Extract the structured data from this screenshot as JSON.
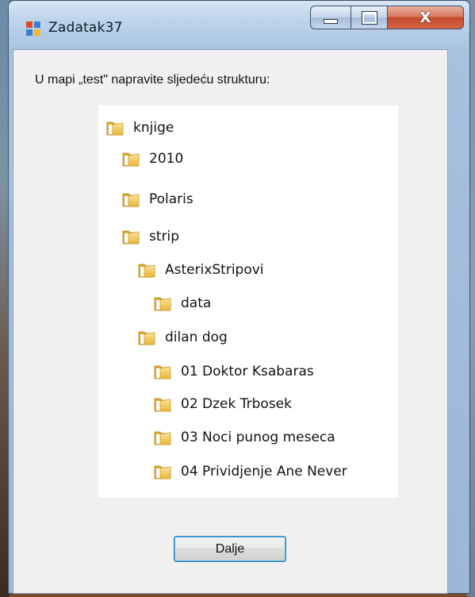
{
  "window": {
    "title": "Zadatak37",
    "controls": {
      "minimize": "minimize",
      "maximize": "maximize",
      "close": "X"
    }
  },
  "instruction": "U mapi „test\" napravite sljedeću strukturu:",
  "tree": [
    {
      "label": "knjige",
      "level": 0
    },
    {
      "label": "2010",
      "level": 1
    },
    {
      "label": "Polaris",
      "level": 1
    },
    {
      "label": "strip",
      "level": 1
    },
    {
      "label": "AsterixStripovi",
      "level": 2
    },
    {
      "label": "data",
      "level": 3
    },
    {
      "label": "dilan dog",
      "level": 2
    },
    {
      "label": "01 Doktor Ksabaras",
      "level": 3
    },
    {
      "label": "02 Dzek Trbosek",
      "level": 3
    },
    {
      "label": "03 Noci punog meseca",
      "level": 3
    },
    {
      "label": "04 Prividjenje Ane Never",
      "level": 3
    }
  ],
  "buttons": {
    "next_label": "Dalje"
  },
  "icons": {
    "app": "app-icon",
    "folder": "folder-icon"
  },
  "colors": {
    "client_bg": "#f0f0f0",
    "tree_bg": "#ffffff",
    "close_red": "#c34a2c",
    "folder_yellow": "#f3c94a"
  }
}
